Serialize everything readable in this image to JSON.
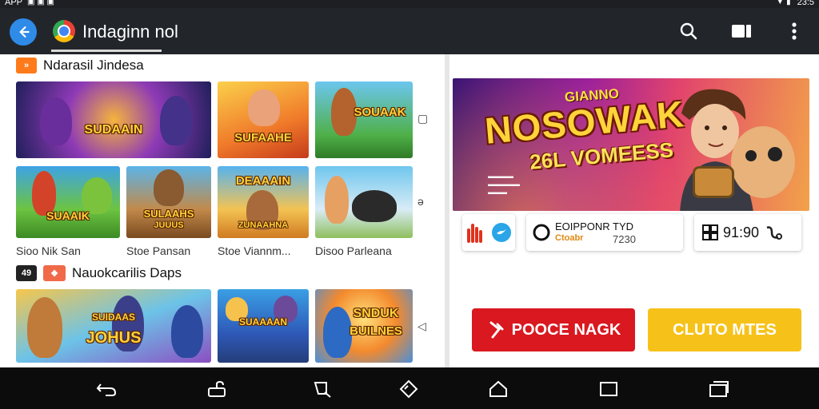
{
  "status_bar": {
    "left_text": "APP",
    "time": "23:5"
  },
  "app_bar": {
    "title": "Indaginn nol"
  },
  "left": {
    "section1": {
      "badge": "»",
      "title": "Ndarasil Jindesa"
    },
    "row1_tiles": [
      {
        "title": "SUDAAIN",
        "sub": ""
      },
      {
        "title": "SUFAAHE",
        "sub": ""
      },
      {
        "title": "SOUAAK",
        "sub": ""
      }
    ],
    "row2_tiles": [
      {
        "title": "SUAAIK",
        "sub": ""
      },
      {
        "title": "SULAAHS",
        "sub": "JUUUS"
      },
      {
        "title": "DEAAAIN",
        "sub": "ZUNAAHNA"
      },
      {
        "title": "",
        "sub": ""
      }
    ],
    "row2_labels": [
      "Sioo Nik San",
      "Stoe Pansan",
      "Stoe Viannm...",
      "Disoo Parleana"
    ],
    "section2": {
      "badge": "49",
      "title": "Nauokcarilis Daps"
    },
    "row3_tiles": [
      {
        "title": "JOHUS",
        "sub": "SUIDAAS"
      },
      {
        "title": "SUAAAAN",
        "sub": ""
      },
      {
        "title": "SNDUK",
        "sub": "BUILNES"
      }
    ],
    "side_glyphs": [
      "▢",
      "ə",
      "◁"
    ]
  },
  "right": {
    "hero": {
      "small_title": "GIANNO",
      "title": "NOSOWAK",
      "sub": "26L VOMEESS"
    },
    "card2": {
      "line1": "EOIPPONR TYD",
      "line2": "Ctoabr",
      "value": "7230"
    },
    "card3": {
      "value": "91:90"
    },
    "cta_red": "POOCE NAGK",
    "cta_yellow": "CLUTO MTES"
  },
  "colors": {
    "app_bar": "#22262b",
    "accent_blue": "#2f8be8",
    "cta_red": "#d91820",
    "cta_yellow": "#f6c21a"
  },
  "icons": [
    "back-arrow-icon",
    "search-icon",
    "cast-icon",
    "more-vert-icon"
  ]
}
